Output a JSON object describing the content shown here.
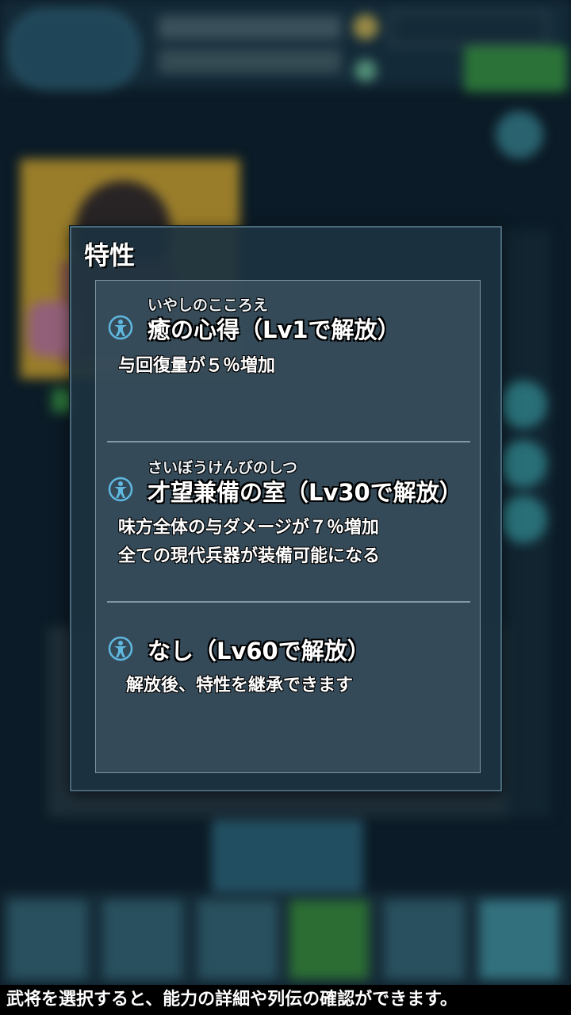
{
  "dialog": {
    "title": "特性",
    "traits": [
      {
        "ruby": "いやしのこころえ",
        "name": "癒の心得（Lv1で解放）",
        "description": [
          "与回復量が５％増加"
        ],
        "icon": "person-figure-icon"
      },
      {
        "ruby": "さいぼうけんびのしつ",
        "name": "才望兼備の室（Lv30で解放）",
        "description": [
          "味方全体の与ダメージが７％増加",
          "全ての現代兵器が装備可能になる"
        ],
        "icon": "person-figure-icon"
      },
      {
        "ruby": "",
        "name": "なし（Lv60で解放）",
        "description": [
          "解放後、特性を継承できます"
        ],
        "icon": "person-figure-icon"
      }
    ]
  },
  "caption": "武将を選択すると、能力の詳細や列伝の確認ができます。",
  "colors": {
    "dialog_bg": "#1c3240",
    "inner_bg": "#3c5260",
    "icon": "#5fb8e0",
    "caption_bg": "#000000"
  }
}
